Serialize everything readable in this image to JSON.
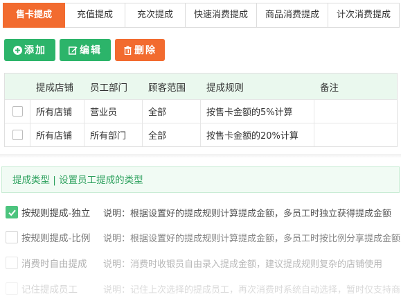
{
  "tabs": [
    {
      "label": "售卡提成",
      "active": true
    },
    {
      "label": "充值提成",
      "active": false
    },
    {
      "label": "充次提成",
      "active": false
    },
    {
      "label": "快速消费提成",
      "active": false
    },
    {
      "label": "商品消费提成",
      "active": false
    },
    {
      "label": "计次消费提成",
      "active": false
    }
  ],
  "toolbar": {
    "add_label": "添加",
    "edit_label": "编辑",
    "delete_label": "删除"
  },
  "table": {
    "headers": [
      "",
      "提成店铺",
      "员工部门",
      "顾客范围",
      "提成规则",
      "备注"
    ],
    "rows": [
      [
        "",
        "所有店铺",
        "营业员",
        "全部",
        "按售卡金额的5%计算",
        ""
      ],
      [
        "",
        "所有店铺",
        "所有部门",
        "全部",
        "按售卡金额的20%计算",
        ""
      ]
    ]
  },
  "panel": {
    "title": "提成类型 | 设置员工提成的类型"
  },
  "options": [
    {
      "label": "按规则提成-独立",
      "desc": "说明：根据设置好的提成规则计算提成金额，多员工时独立获得提成金额",
      "checked": true
    },
    {
      "label": "按规则提成-比例",
      "desc": "说明：根据设置好的提成规则计算提成金额，多员工时按比例分享提成金额",
      "checked": false
    },
    {
      "label": "消费时自由提成",
      "desc": "说明：消费时收银员自由录入提成金额，建议提成规则复杂的店铺使用",
      "checked": false
    },
    {
      "label": "记住提成员工",
      "desc": "说明：记住上次选择的提成员工，再次消费时系统自动选择，暂时仅支持商",
      "checked": false
    }
  ],
  "colors": {
    "accent_orange": "#f26b2f",
    "accent_green": "#2cb46a",
    "header_green_bg": "#eaf8ee",
    "checkbox_checked": "#4cc47e"
  }
}
